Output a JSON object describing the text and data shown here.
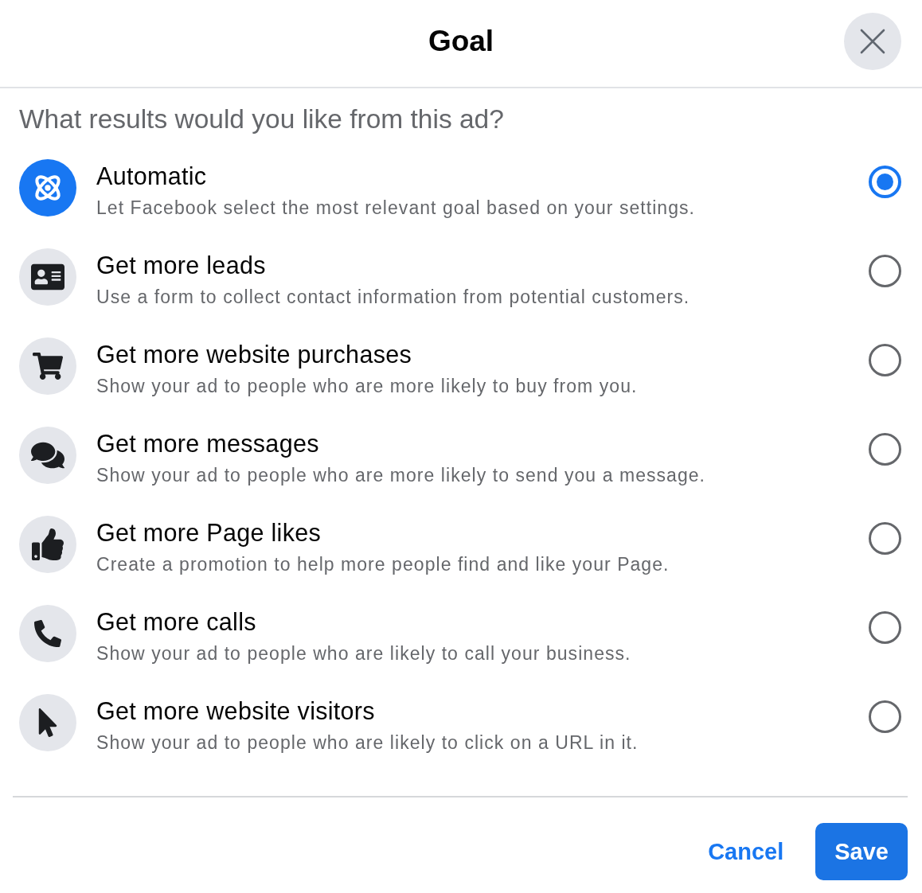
{
  "dialog": {
    "title": "Goal"
  },
  "question": "What results would you like from this ad?",
  "options": [
    {
      "kind": "automatic",
      "title": "Automatic",
      "description": "Let Facebook select the most relevant goal based on your settings.",
      "selected": true
    },
    {
      "kind": "leads",
      "title": "Get more leads",
      "description": "Use a form to collect contact information from potential customers.",
      "selected": false
    },
    {
      "kind": "purchases",
      "title": "Get more website purchases",
      "description": "Show your ad to people who are more likely to buy from you.",
      "selected": false
    },
    {
      "kind": "messages",
      "title": "Get more messages",
      "description": "Show your ad to people who are more likely to send you a message.",
      "selected": false
    },
    {
      "kind": "page_likes",
      "title": "Get more Page likes",
      "description": "Create a promotion to help more people find and like your Page.",
      "selected": false
    },
    {
      "kind": "calls",
      "title": "Get more calls",
      "description": "Show your ad to people who are likely to call your business.",
      "selected": false
    },
    {
      "kind": "visitors",
      "title": "Get more website visitors",
      "description": "Show your ad to people who are likely to click on a URL in it.",
      "selected": false
    }
  ],
  "footer": {
    "cancel": "Cancel",
    "save": "Save"
  }
}
